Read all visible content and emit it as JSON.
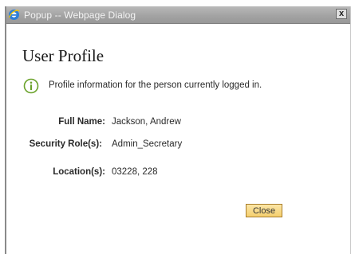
{
  "window": {
    "title": "Popup -- Webpage Dialog",
    "close_glyph": "x",
    "app_icon": "ie-icon",
    "close_icon": "close-icon"
  },
  "page": {
    "title": "User Profile",
    "info_icon": "info-icon",
    "info_text": "Profile information for the person currently logged in."
  },
  "fields": {
    "full_name": {
      "label": "Full Name:",
      "value": "Jackson, Andrew"
    },
    "security_roles": {
      "label": "Security Role(s):",
      "value": "Admin_Secretary"
    },
    "locations": {
      "label": "Location(s):",
      "value": "03228, 228"
    }
  },
  "actions": {
    "close_label": "Close"
  },
  "colors": {
    "titlebar": "#a3a3a3",
    "button_fill": "#f5cf6e",
    "info_icon": "#6aa22a"
  }
}
